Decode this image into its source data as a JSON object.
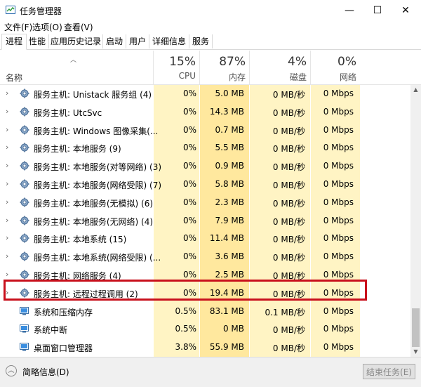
{
  "window": {
    "title": "任务管理器",
    "minimize_glyph": "—",
    "maximize_glyph": "☐",
    "close_glyph": "✕"
  },
  "menu": [
    "文件(F)",
    "选项(O)",
    "查看(V)"
  ],
  "tabs": [
    {
      "label": "进程",
      "active": true
    },
    {
      "label": "性能"
    },
    {
      "label": "应用历史记录"
    },
    {
      "label": "启动"
    },
    {
      "label": "用户"
    },
    {
      "label": "详细信息"
    },
    {
      "label": "服务"
    }
  ],
  "columns": {
    "name": "名称",
    "cpu": {
      "pct": "15%",
      "label": "CPU"
    },
    "memory": {
      "pct": "87%",
      "label": "内存"
    },
    "disk": {
      "pct": "4%",
      "label": "磁盘"
    },
    "network": {
      "pct": "0%",
      "label": "网络"
    }
  },
  "rows": [
    {
      "name": "服务主机: Unistack 服务组 (4)",
      "cpu": "0%",
      "mem": "5.0 MB",
      "disk": "0 MB/秒",
      "net": "0 Mbps",
      "icon": "gear-icon",
      "expandable": true
    },
    {
      "name": "服务主机: UtcSvc",
      "cpu": "0%",
      "mem": "14.3 MB",
      "disk": "0 MB/秒",
      "net": "0 Mbps",
      "icon": "gear-icon",
      "expandable": true
    },
    {
      "name": "服务主机: Windows 图像采集(...",
      "cpu": "0%",
      "mem": "0.7 MB",
      "disk": "0 MB/秒",
      "net": "0 Mbps",
      "icon": "gear-icon",
      "expandable": true
    },
    {
      "name": "服务主机: 本地服务 (9)",
      "cpu": "0%",
      "mem": "5.5 MB",
      "disk": "0 MB/秒",
      "net": "0 Mbps",
      "icon": "gear-icon",
      "expandable": true
    },
    {
      "name": "服务主机: 本地服务(对等网络) (3)",
      "cpu": "0%",
      "mem": "0.9 MB",
      "disk": "0 MB/秒",
      "net": "0 Mbps",
      "icon": "gear-icon",
      "expandable": true
    },
    {
      "name": "服务主机: 本地服务(网络受限) (7)",
      "cpu": "0%",
      "mem": "5.8 MB",
      "disk": "0 MB/秒",
      "net": "0 Mbps",
      "icon": "gear-icon",
      "expandable": true
    },
    {
      "name": "服务主机: 本地服务(无模拟) (6)",
      "cpu": "0%",
      "mem": "2.3 MB",
      "disk": "0 MB/秒",
      "net": "0 Mbps",
      "icon": "gear-icon",
      "expandable": true
    },
    {
      "name": "服务主机: 本地服务(无网络) (4)",
      "cpu": "0%",
      "mem": "7.9 MB",
      "disk": "0 MB/秒",
      "net": "0 Mbps",
      "icon": "gear-icon",
      "expandable": true
    },
    {
      "name": "服务主机: 本地系统 (15)",
      "cpu": "0%",
      "mem": "11.4 MB",
      "disk": "0 MB/秒",
      "net": "0 Mbps",
      "icon": "gear-icon",
      "expandable": true
    },
    {
      "name": "服务主机: 本地系统(网络受限) (...",
      "cpu": "0%",
      "mem": "3.6 MB",
      "disk": "0 MB/秒",
      "net": "0 Mbps",
      "icon": "gear-icon",
      "expandable": true
    },
    {
      "name": "服务主机: 网络服务 (4)",
      "cpu": "0%",
      "mem": "2.5 MB",
      "disk": "0 MB/秒",
      "net": "0 Mbps",
      "icon": "gear-icon",
      "expandable": true
    },
    {
      "name": "服务主机: 远程过程调用 (2)",
      "cpu": "0%",
      "mem": "19.4 MB",
      "disk": "0 MB/秒",
      "net": "0 Mbps",
      "icon": "gear-icon",
      "expandable": true
    },
    {
      "name": "系统和压缩内存",
      "cpu": "0.5%",
      "mem": "83.1 MB",
      "disk": "0.1 MB/秒",
      "net": "0 Mbps",
      "icon": "system-icon",
      "expandable": false
    },
    {
      "name": "系统中断",
      "cpu": "0.5%",
      "mem": "0 MB",
      "disk": "0 MB/秒",
      "net": "0 Mbps",
      "icon": "system-icon",
      "expandable": false
    },
    {
      "name": "桌面窗口管理器",
      "cpu": "3.8%",
      "mem": "55.9 MB",
      "disk": "0 MB/秒",
      "net": "0 Mbps",
      "icon": "system-icon",
      "expandable": false
    }
  ],
  "footer": {
    "fewer_details": "简略信息(D)",
    "end_task": "结束任务(E)"
  },
  "colors": {
    "cpu_bg": "#fff4c4",
    "mem_bg": "#ffe89e",
    "highlight_border": "#c8101c"
  }
}
